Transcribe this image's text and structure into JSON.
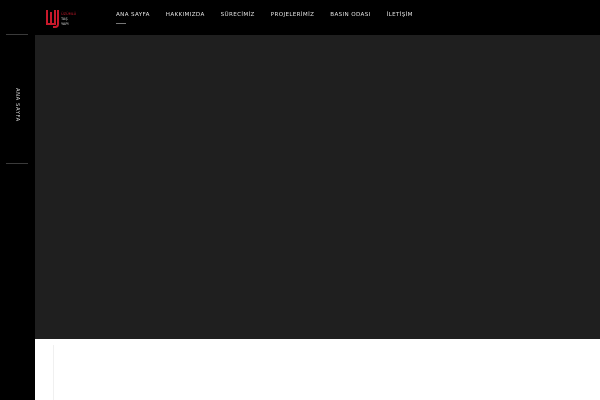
{
  "brand": {
    "logo_icon": "wj-logo-icon",
    "logo_text": [
      "ÜZÜMLÜ",
      "TAŞ",
      "YAPI"
    ],
    "accent": "#c8192b"
  },
  "nav": {
    "items": [
      {
        "label": "ANA SAYFA"
      },
      {
        "label": "HAKKIMIZDA"
      },
      {
        "label": "SÜRECİMİZ"
      },
      {
        "label": "PROJELERİMİZ"
      },
      {
        "label": "BASIN ODASI"
      },
      {
        "label": "İLETİŞİM"
      }
    ],
    "active_index": 0
  },
  "sidebar": {
    "current_page": "ANA SAYFA"
  },
  "colors": {
    "background": "#000000",
    "hero": "#1f1f1f",
    "content": "#ffffff",
    "nav_text": "#e6e6e6"
  }
}
